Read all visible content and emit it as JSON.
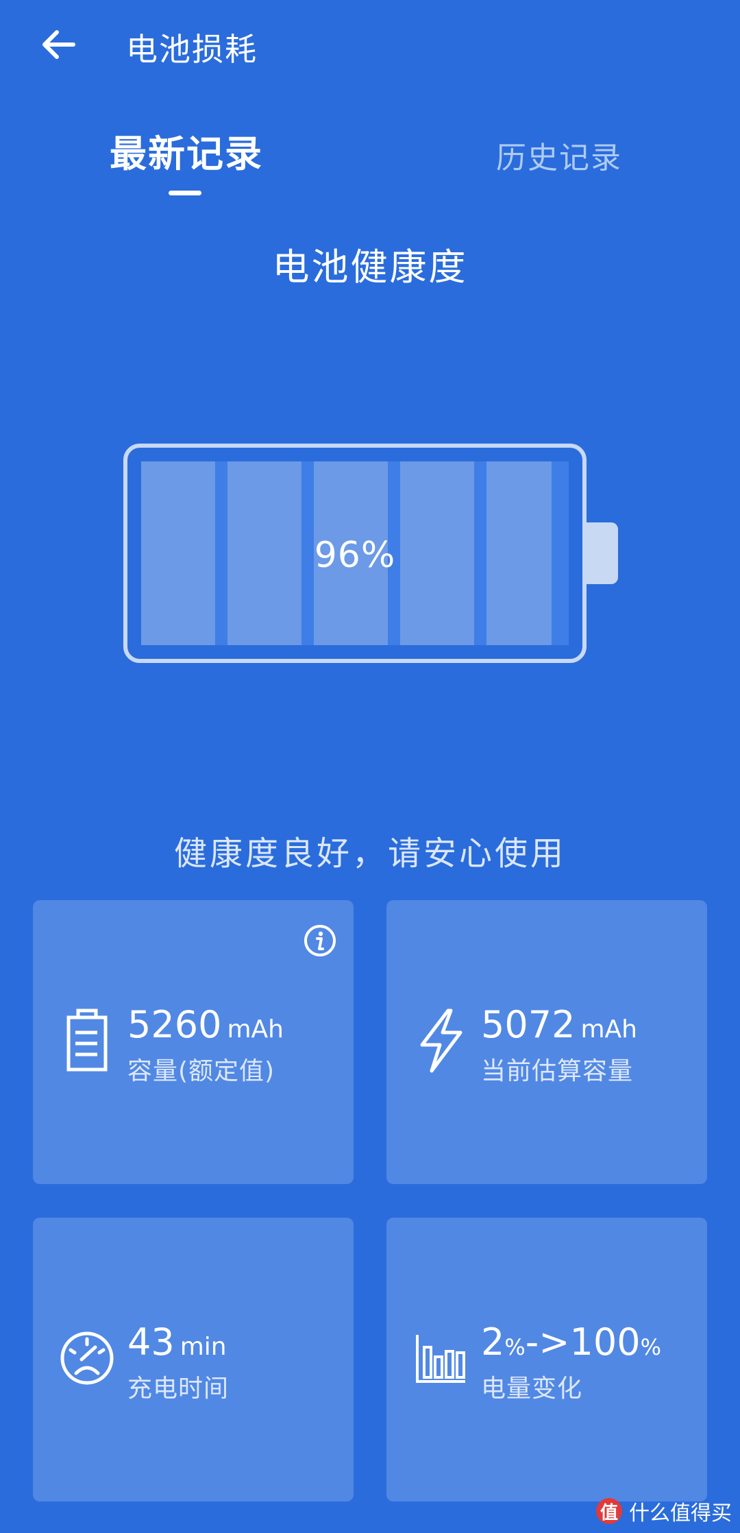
{
  "header": {
    "title": "电池损耗",
    "back_icon": "arrow-left-icon"
  },
  "tabs": [
    {
      "label": "最新记录",
      "active": true
    },
    {
      "label": "历史记录",
      "active": false
    }
  ],
  "battery": {
    "section_title": "电池健康度",
    "percent_label": "96%",
    "health_fraction": 0.96,
    "status_message": "健康度良好，请安心使用"
  },
  "cards": [
    {
      "icon": "battery-icon",
      "value": "5260",
      "unit": "mAh",
      "label": "容量(额定值)",
      "has_info": true,
      "info_icon": "info-icon"
    },
    {
      "icon": "lightning-icon",
      "value": "5072",
      "unit": "mAh",
      "label": "当前估算容量"
    },
    {
      "icon": "speedometer-icon",
      "value": "43",
      "unit": "min",
      "label": "充电时间"
    },
    {
      "icon": "bar-chart-icon",
      "value_from": "2",
      "value_to": "100",
      "pct": "%",
      "arrow": "->",
      "label": "电量变化"
    }
  ],
  "watermark": {
    "logo": "值",
    "text": "什么值得买"
  },
  "colors": {
    "background": "#2a6cdc",
    "card": "#5188e4",
    "battery_cell": "#6c9ae6",
    "tab_inactive": "#aecbf3"
  }
}
